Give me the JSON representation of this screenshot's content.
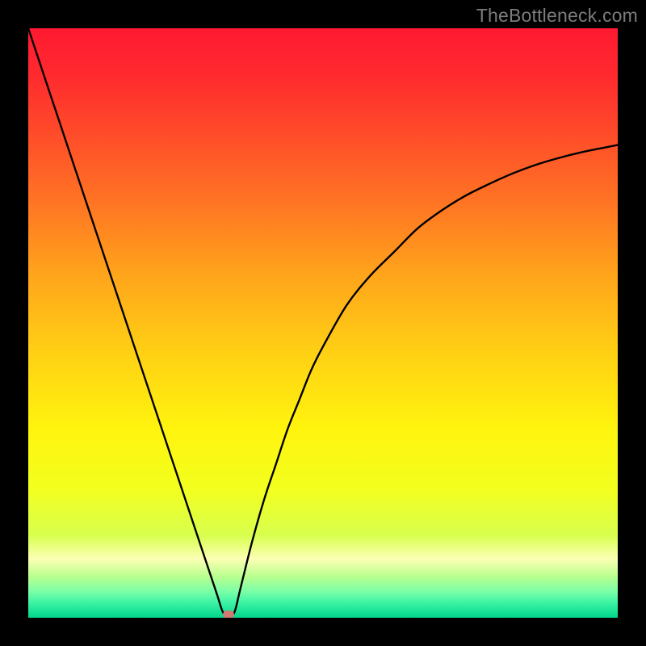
{
  "watermark": "TheBottleneck.com",
  "chart_data": {
    "type": "line",
    "title": "",
    "xlabel": "",
    "ylabel": "",
    "xlim": [
      0,
      100
    ],
    "ylim": [
      0,
      100
    ],
    "x": [
      0,
      2,
      4,
      6,
      8,
      10,
      12,
      14,
      16,
      18,
      20,
      22,
      24,
      26,
      28,
      30,
      32,
      33,
      34,
      35,
      36,
      38,
      40,
      42,
      44,
      46,
      48,
      50,
      54,
      58,
      62,
      66,
      70,
      74,
      78,
      82,
      86,
      90,
      94,
      98,
      100
    ],
    "series": [
      {
        "name": "curve",
        "values": [
          100,
          94,
          88,
          82,
          76,
          70,
          64,
          58,
          52,
          46,
          40,
          34,
          28,
          22,
          16,
          10,
          4,
          1,
          0,
          1,
          5,
          13,
          20,
          26,
          32,
          37,
          42,
          46,
          53,
          58,
          62,
          66,
          69,
          71.5,
          73.5,
          75.3,
          76.8,
          78,
          79,
          79.8,
          80.2
        ]
      }
    ],
    "marker": {
      "x": 34,
      "y": 0.5,
      "color": "#cf7b73"
    },
    "gradient_stops": [
      {
        "offset": 0,
        "color": "#ff1931"
      },
      {
        "offset": 0.08,
        "color": "#ff2a2e"
      },
      {
        "offset": 0.18,
        "color": "#ff4c2a"
      },
      {
        "offset": 0.3,
        "color": "#ff7623"
      },
      {
        "offset": 0.42,
        "color": "#ffa51b"
      },
      {
        "offset": 0.55,
        "color": "#ffd014"
      },
      {
        "offset": 0.68,
        "color": "#fff40e"
      },
      {
        "offset": 0.78,
        "color": "#f3ff1e"
      },
      {
        "offset": 0.86,
        "color": "#d8ff4e"
      },
      {
        "offset": 0.9,
        "color": "#fcffb4"
      },
      {
        "offset": 0.93,
        "color": "#b9ff8e"
      },
      {
        "offset": 0.955,
        "color": "#7cffa7"
      },
      {
        "offset": 0.975,
        "color": "#3cf3a4"
      },
      {
        "offset": 1.0,
        "color": "#00d68b"
      }
    ]
  }
}
